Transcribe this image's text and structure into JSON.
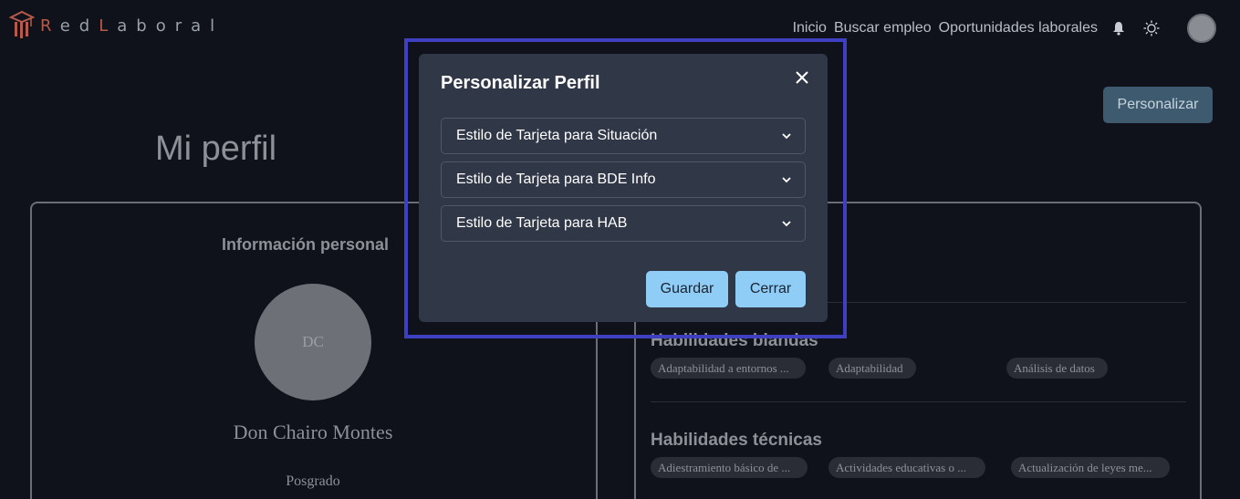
{
  "navbar": {
    "logo_text": "RedLaboral",
    "links": [
      "Inicio",
      "Buscar empleo",
      "Oportunidades laborales"
    ],
    "icons": [
      "bell-icon",
      "sun-icon"
    ]
  },
  "header": {
    "personalize_button": "Personalizar",
    "page_title": "Mi perfil"
  },
  "profile": {
    "section_title": "Información personal",
    "initials": "DC",
    "name": "Don Chairo Montes",
    "level": "Posgrado"
  },
  "skills": {
    "soft_title": "Habilidades blandas",
    "soft": [
      "Adaptabilidad a entornos ...",
      "Adaptabilidad",
      "Análisis de datos"
    ],
    "tech_title": "Habilidades técnicas",
    "tech": [
      "Adiestramiento básico de ...",
      "Actividades educativas o ...",
      "Actualización de leyes me..."
    ]
  },
  "modal": {
    "title": "Personalizar Perfil",
    "selects": [
      {
        "value": "Estilo de Tarjeta para Situación"
      },
      {
        "value": "Estilo de Tarjeta para BDE Info"
      },
      {
        "value": "Estilo de Tarjeta para HAB"
      }
    ],
    "save_label": "Guardar",
    "close_label": "Cerrar"
  },
  "colors": {
    "background": "#0f121a",
    "modal_bg": "#303747",
    "primary_button": "#8fcdf6",
    "highlight": "#3f3fc2",
    "personalize_button": "#3e5a6e"
  }
}
